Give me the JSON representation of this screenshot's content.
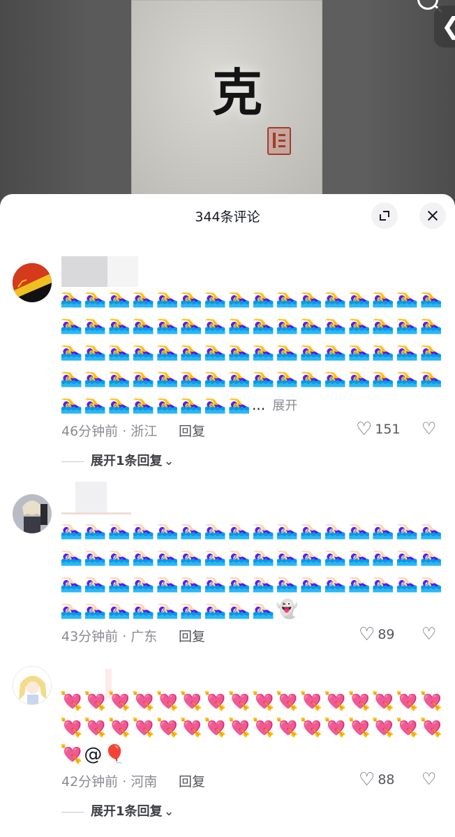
{
  "video": {
    "calligraphy_char": "克",
    "icons": {
      "search": "search-icon",
      "collapse": "chevron-left-icon"
    },
    "collapse_glyph": "❮"
  },
  "sheet": {
    "title": "344条评论",
    "icons": {
      "expand": "expand-icon",
      "close": "close-icon"
    }
  },
  "comments": [
    {
      "avatar_icon": "avatar-red-black",
      "rows": [
        "🏊‍♀️🏊‍♀️🏊‍♀️🏊‍♀️🏊‍♀️🏊‍♀️🏊‍♀️🏊‍♀️🏊‍♀️🏊‍♀️🏊‍♀️🏊‍♀️🏊‍♀️🏊‍♀️🏊‍♀️🏊‍♀️",
        "🏊‍♀️🏊‍♀️🏊‍♀️🏊‍♀️🏊‍♀️🏊‍♀️🏊‍♀️🏊‍♀️🏊‍♀️🏊‍♀️🏊‍♀️🏊‍♀️🏊‍♀️🏊‍♀️🏊‍♀️🏊‍♀️",
        "🏊‍♀️🏊‍♀️🏊‍♀️🏊‍♀️🏊‍♀️🏊‍♀️🏊‍♀️🏊‍♀️🏊‍♀️🏊‍♀️🏊‍♀️🏊‍♀️🏊‍♀️🏊‍♀️🏊‍♀️🏊‍♀️",
        "🏊‍♀️🏊‍♀️🏊‍♀️🏊‍♀️🏊‍♀️🏊‍♀️🏊‍♀️🏊‍♀️🏊‍♀️🏊‍♀️🏊‍♀️🏊‍♀️🏊‍♀️🏊‍♀️🏊‍♀️🏊‍♀️",
        "🏊‍♀️🏊‍♀️🏊‍♀️🏊‍♀️🏊‍♀️🏊‍♀️🏊‍♀️🏊‍♀️"
      ],
      "ellipsis": "...",
      "more_label": "展开",
      "meta": "46分钟前 · 浙江",
      "reply_label": "回复",
      "likes": "151",
      "expand_label": "展开1条回复",
      "expand_chevron": "⌄"
    },
    {
      "avatar_icon": "avatar-anime-photo",
      "rows": [
        "🏊🏻‍♀️🏊🏻‍♀️🏊🏻‍♀️🏊🏻‍♀️🏊🏻‍♀️🏊🏻‍♀️🏊🏻‍♀️🏊🏻‍♀️🏊🏻‍♀️🏊🏻‍♀️🏊🏻‍♀️🏊🏻‍♀️🏊🏻‍♀️🏊🏻‍♀️🏊🏻‍♀️🏊🏻‍♀️",
        "🏊🏻‍♀️🏊🏻‍♀️🏊🏻‍♀️🏊🏻‍♀️🏊🏻‍♀️🏊🏻‍♀️🏊🏻‍♀️🏊🏻‍♀️🏊🏻‍♀️🏊🏻‍♀️🏊🏻‍♀️🏊🏻‍♀️🏊🏻‍♀️🏊🏻‍♀️🏊🏻‍♀️🏊🏻‍♀️",
        "🏊🏻‍♀️🏊🏻‍♀️🏊🏻‍♀️🏊🏻‍♀️🏊🏻‍♀️🏊🏻‍♀️🏊🏻‍♀️🏊🏻‍♀️🏊🏻‍♀️🏊🏻‍♀️🏊🏻‍♀️🏊🏻‍♀️🏊🏻‍♀️🏊🏻‍♀️🏊🏻‍♀️🏊🏻‍♀️",
        "🏊🏻‍♀️🏊🏻‍♀️🏊🏻‍♀️🏊🏻‍♀️🏊🏻‍♀️🏊🏻‍♀️🏊🏻‍♀️🏊🏻‍♀️🏊🏻‍♀️👻"
      ],
      "meta": "43分钟前 · 广东",
      "reply_label": "回复",
      "likes": "89"
    },
    {
      "avatar_icon": "avatar-anime-girl",
      "rows": [
        "💘💘💘💘💘💘💘💘💘💘💘💘💘💘💘💘",
        "💘💘💘💘💘💘💘💘💘💘💘💘💘💘💘💘",
        "💘@🎈"
      ],
      "meta": "42分钟前 · 河南",
      "reply_label": "回复",
      "likes": "88",
      "expand_label": "展开1条回复",
      "expand_chevron": "⌄"
    }
  ],
  "glyphs": {
    "heart": "♡",
    "dislike": "♡"
  },
  "colors": {
    "text": "#161823",
    "secondary": "#8a8b91",
    "icon": "#55565c"
  }
}
